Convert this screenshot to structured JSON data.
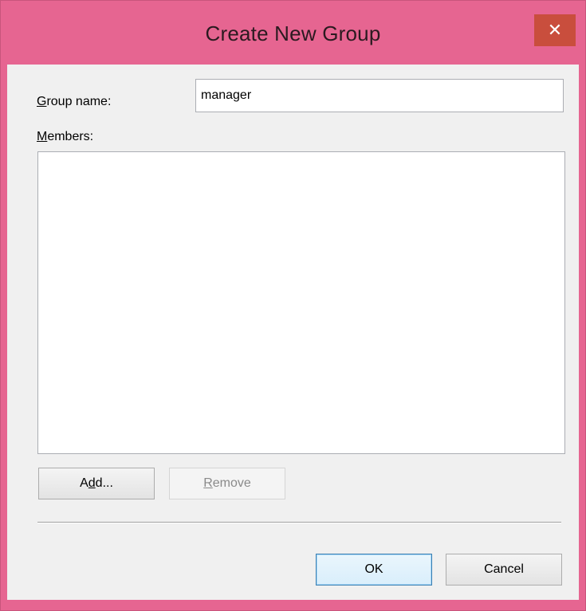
{
  "window": {
    "title": "Create New Group",
    "close_glyph": "✕",
    "accent_color": "#e66591"
  },
  "form": {
    "group_name": {
      "label_mnemonic": "G",
      "label_rest": "roup name:",
      "value": "manager"
    },
    "members": {
      "label_mnemonic": "M",
      "label_rest": "embers:",
      "items": []
    }
  },
  "buttons": {
    "add": {
      "pre": "A",
      "mnemonic": "d",
      "post": "d...",
      "enabled": true
    },
    "remove": {
      "mnemonic": "R",
      "post": "emove",
      "enabled": false
    },
    "ok": "OK",
    "cancel": "Cancel"
  }
}
